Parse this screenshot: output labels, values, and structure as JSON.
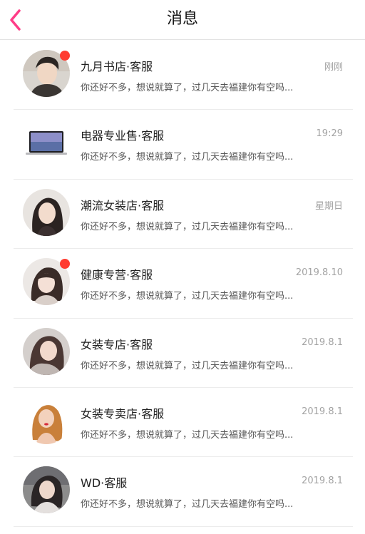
{
  "header": {
    "title": "消息",
    "accent": "#ff3d87"
  },
  "conversations": [
    {
      "name": "九月书店·客服",
      "time": "刚刚",
      "preview": "你还好不多，想说就算了，过几天去福建你有空吗...",
      "unread": true,
      "avatar": "person-avatar-male"
    },
    {
      "name": "电器专业售·客服",
      "time": "19:29",
      "preview": "你还好不多，想说就算了，过几天去福建你有空吗...",
      "unread": false,
      "avatar": "laptop-avatar"
    },
    {
      "name": "潮流女装店·客服",
      "time": "星期日",
      "preview": "你还好不多，想说就算了，过几天去福建你有空吗...",
      "unread": false,
      "avatar": "person-avatar-female"
    },
    {
      "name": "健康专营·客服",
      "time": "2019.8.10",
      "preview": "你还好不多，想说就算了，过几天去福建你有空吗...",
      "unread": true,
      "avatar": "person-avatar-female"
    },
    {
      "name": "女装专店·客服",
      "time": "2019.8.1",
      "preview": "你还好不多，想说就算了，过几天去福建你有空吗...",
      "unread": false,
      "avatar": "person-avatar-female"
    },
    {
      "name": "女装专卖店·客服",
      "time": "2019.8.1",
      "preview": "你还好不多，想说就算了，过几天去福建你有空吗...",
      "unread": false,
      "avatar": "person-avatar-female"
    },
    {
      "name": "WD·客服",
      "time": "2019.8.1",
      "preview": "你还好不多，想说就算了，过几天去福建你有空吗...",
      "unread": false,
      "avatar": "person-avatar-female"
    }
  ]
}
